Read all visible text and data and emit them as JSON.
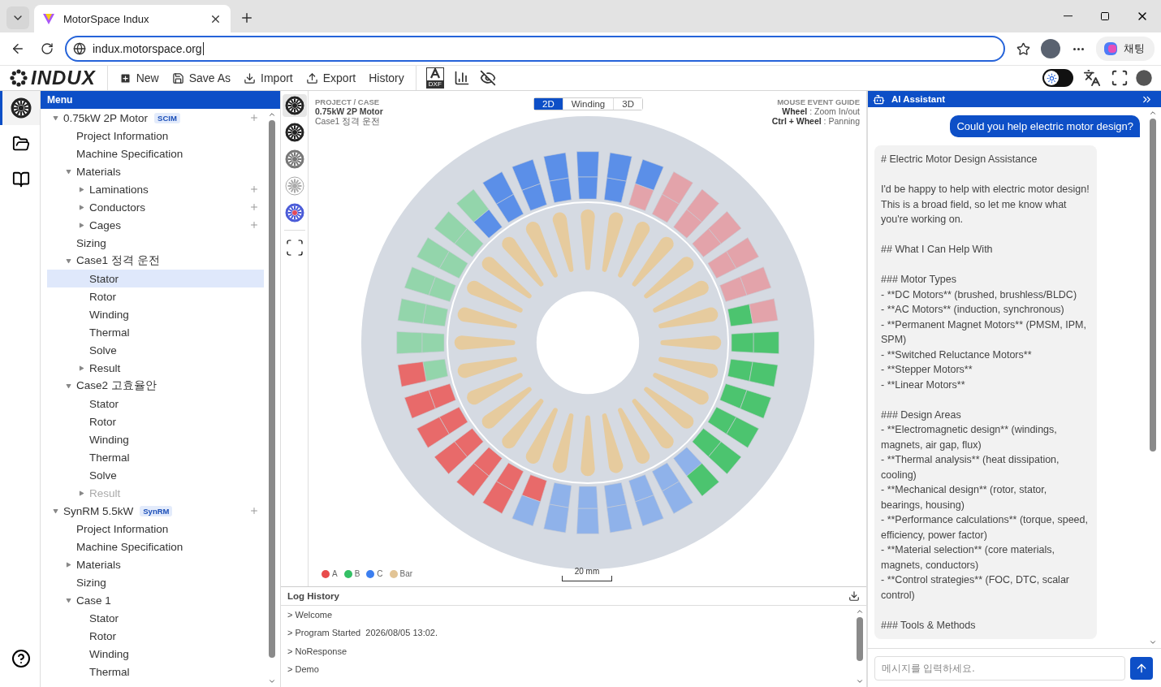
{
  "browser": {
    "tab_title": "MotorSpace Indux",
    "url": "indux.motorspace.org",
    "chat_button": "채팅"
  },
  "toolbar": {
    "logo": "INDUX",
    "actions": [
      {
        "label": "New",
        "kind": "new"
      },
      {
        "label": "Save As",
        "kind": "save"
      },
      {
        "label": "Import",
        "kind": "import"
      },
      {
        "label": "Export",
        "kind": "export"
      },
      {
        "label": "History",
        "kind": "text"
      }
    ],
    "dxf_label": "DXF",
    "dark_mode": false
  },
  "rail": [
    {
      "kind": "motor",
      "selected": true
    },
    {
      "kind": "folder",
      "selected": false
    },
    {
      "kind": "book",
      "selected": false
    }
  ],
  "menu": {
    "title": "Menu",
    "tree": [
      {
        "label": "0.75kW 2P Motor",
        "badge": "SCIM",
        "expanded": true,
        "add": true,
        "selected": false,
        "disabled": false,
        "children": [
          {
            "label": "Project Information",
            "selected": false,
            "disabled": false
          },
          {
            "label": "Machine Specification",
            "selected": false,
            "disabled": false
          },
          {
            "label": "Materials",
            "expanded": true,
            "selected": false,
            "disabled": false,
            "children": [
              {
                "label": "Laminations",
                "expanded": false,
                "add": true,
                "selected": false,
                "disabled": false
              },
              {
                "label": "Conductors",
                "expanded": false,
                "add": true,
                "selected": false,
                "disabled": false
              },
              {
                "label": "Cages",
                "expanded": false,
                "add": true,
                "selected": false,
                "disabled": false
              }
            ]
          },
          {
            "label": "Sizing",
            "selected": false,
            "disabled": false
          },
          {
            "label": "Case1 정격 운전",
            "expanded": true,
            "selected": false,
            "disabled": false,
            "children": [
              {
                "label": "Stator",
                "selected": true,
                "disabled": false
              },
              {
                "label": "Rotor",
                "selected": false,
                "disabled": false
              },
              {
                "label": "Winding",
                "selected": false,
                "disabled": false
              },
              {
                "label": "Thermal",
                "selected": false,
                "disabled": false
              },
              {
                "label": "Solve",
                "selected": false,
                "disabled": false
              },
              {
                "label": "Result",
                "expanded": false,
                "selected": false,
                "disabled": false
              }
            ]
          },
          {
            "label": "Case2 고효율안",
            "expanded": true,
            "selected": false,
            "disabled": false,
            "children": [
              {
                "label": "Stator",
                "selected": false,
                "disabled": false
              },
              {
                "label": "Rotor",
                "selected": false,
                "disabled": false
              },
              {
                "label": "Winding",
                "selected": false,
                "disabled": false
              },
              {
                "label": "Thermal",
                "selected": false,
                "disabled": false
              },
              {
                "label": "Solve",
                "selected": false,
                "disabled": false
              },
              {
                "label": "Result",
                "expanded": false,
                "selected": false,
                "disabled": true
              }
            ]
          }
        ]
      },
      {
        "label": "SynRM 5.5kW",
        "badge": "SynRM",
        "expanded": true,
        "add": true,
        "selected": false,
        "disabled": false,
        "children": [
          {
            "label": "Project Information",
            "selected": false,
            "disabled": false
          },
          {
            "label": "Machine Specification",
            "selected": false,
            "disabled": false
          },
          {
            "label": "Materials",
            "expanded": false,
            "selected": false,
            "disabled": false
          },
          {
            "label": "Sizing",
            "selected": false,
            "disabled": false
          },
          {
            "label": "Case 1",
            "expanded": true,
            "selected": false,
            "disabled": false,
            "children": [
              {
                "label": "Stator",
                "selected": false,
                "disabled": false
              },
              {
                "label": "Rotor",
                "selected": false,
                "disabled": false
              },
              {
                "label": "Winding",
                "selected": false,
                "disabled": false
              },
              {
                "label": "Thermal",
                "selected": false,
                "disabled": false
              }
            ]
          }
        ]
      }
    ]
  },
  "views": [
    {
      "kind": "dark",
      "selected": true
    },
    {
      "kind": "dark",
      "selected": false
    },
    {
      "kind": "grey",
      "selected": false
    },
    {
      "kind": "light",
      "selected": false
    },
    {
      "kind": "colored",
      "selected": false
    }
  ],
  "canvas": {
    "caption": "PROJECT / CASE",
    "project": "0.75kW 2P Motor",
    "case": "Case1 정격 운전",
    "tabs": [
      {
        "label": "2D",
        "selected": true
      },
      {
        "label": "Winding",
        "selected": false
      },
      {
        "label": "3D",
        "selected": false
      }
    ],
    "guide_title": "MOUSE EVENT GUIDE",
    "guide": [
      "**Wheel** : Zoom In/out",
      "**Ctrl + Wheel** : Panning"
    ],
    "legend": [
      {
        "label": "A",
        "color": "#e84b4b"
      },
      {
        "label": "B",
        "color": "#34c065"
      },
      {
        "label": "C",
        "color": "#3c7ff0"
      },
      {
        "label": "Bar",
        "color": "#e2c495"
      }
    ],
    "scale": "20 mm"
  },
  "log": {
    "title": "Log History",
    "entries": [
      "> Welcome",
      "> Program Started  2026/08/05 13:02.",
      "> NoResponse",
      "> Demo"
    ]
  },
  "chat": {
    "title": "AI Assistant",
    "messages": [
      {
        "kind": "user",
        "text": "Could you help electric motor design?"
      },
      {
        "kind": "assistant",
        "blocks": [
          [
            "# Electric Motor Design Assistance"
          ],
          [
            "I'd be happy to help with electric motor design! This is a broad field, so let me know what you're working on."
          ],
          [
            "## What I Can Help With"
          ],
          [
            "### Motor Types",
            "- **DC Motors** (brushed, brushless/BLDC)",
            "- **AC Motors** (induction, synchronous)",
            "- **Permanent Magnet Motors** (PMSM, IPM, SPM)",
            "- **Switched Reluctance Motors**",
            "- **Stepper Motors**",
            "- **Linear Motors**"
          ],
          [
            "### Design Areas",
            "- **Electromagnetic design** (windings, magnets, air gap, flux)",
            "- **Thermal analysis** (heat dissipation, cooling)",
            "- **Mechanical design** (rotor, stator, bearings, housing)",
            "- **Performance calculations** (torque, speed, efficiency, power factor)",
            "- **Material selection** (core materials, magnets, conductors)",
            "- **Control strategies** (FOC, DTC, scalar control)"
          ],
          [
            "### Tools & Methods"
          ]
        ]
      }
    ],
    "placeholder": "메시지를 입력하세요."
  }
}
